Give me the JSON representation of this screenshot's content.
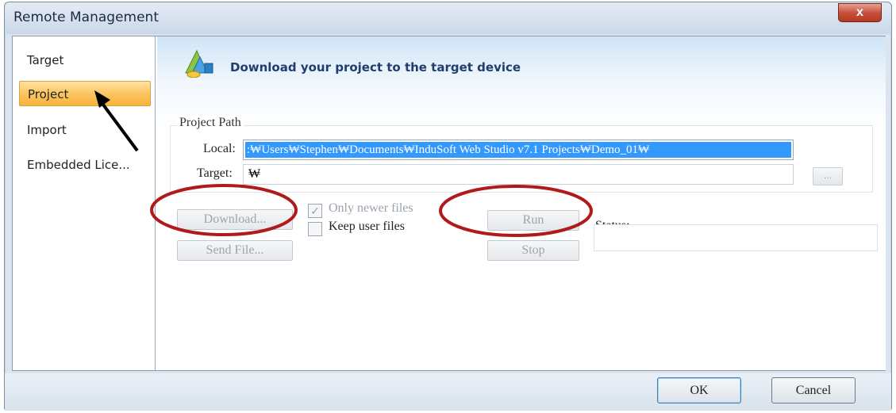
{
  "window": {
    "title": "Remote Management",
    "close_label": "x"
  },
  "sidebar": {
    "items": [
      {
        "label": "Target",
        "selected": false
      },
      {
        "label": "Project",
        "selected": true
      },
      {
        "label": "Import",
        "selected": false
      },
      {
        "label": "Embedded Lice...",
        "selected": false
      }
    ]
  },
  "header": {
    "icon": "project-download-icon",
    "text": "Download your project to the target device"
  },
  "project_path": {
    "legend": "Project Path",
    "local_label": "Local:",
    "local_value": ":\\Users\\Stephen\\Documents\\InduSoft Web Studio v7.1 Projects\\Demo_01\\",
    "local_display": ":₩Users₩Stephen₩Documents₩InduSoft Web Studio v7.1 Projects₩Demo_01₩",
    "target_label": "Target:",
    "target_value": "₩",
    "browse_label": "..."
  },
  "actions": {
    "download_label": "Download...",
    "send_file_label": "Send File...",
    "only_newer_label": "Only newer files",
    "only_newer_checked": true,
    "keep_user_label": "Keep user files",
    "keep_user_checked": false,
    "run_label": "Run",
    "stop_label": "Stop",
    "status_label": "Status:"
  },
  "footer": {
    "ok_label": "OK",
    "cancel_label": "Cancel"
  },
  "colors": {
    "selection_highlight": "#3399ff",
    "selected_nav": "#fbc561",
    "annotation_circle": "#b01a1a",
    "annotation_arrow": "#000000"
  }
}
